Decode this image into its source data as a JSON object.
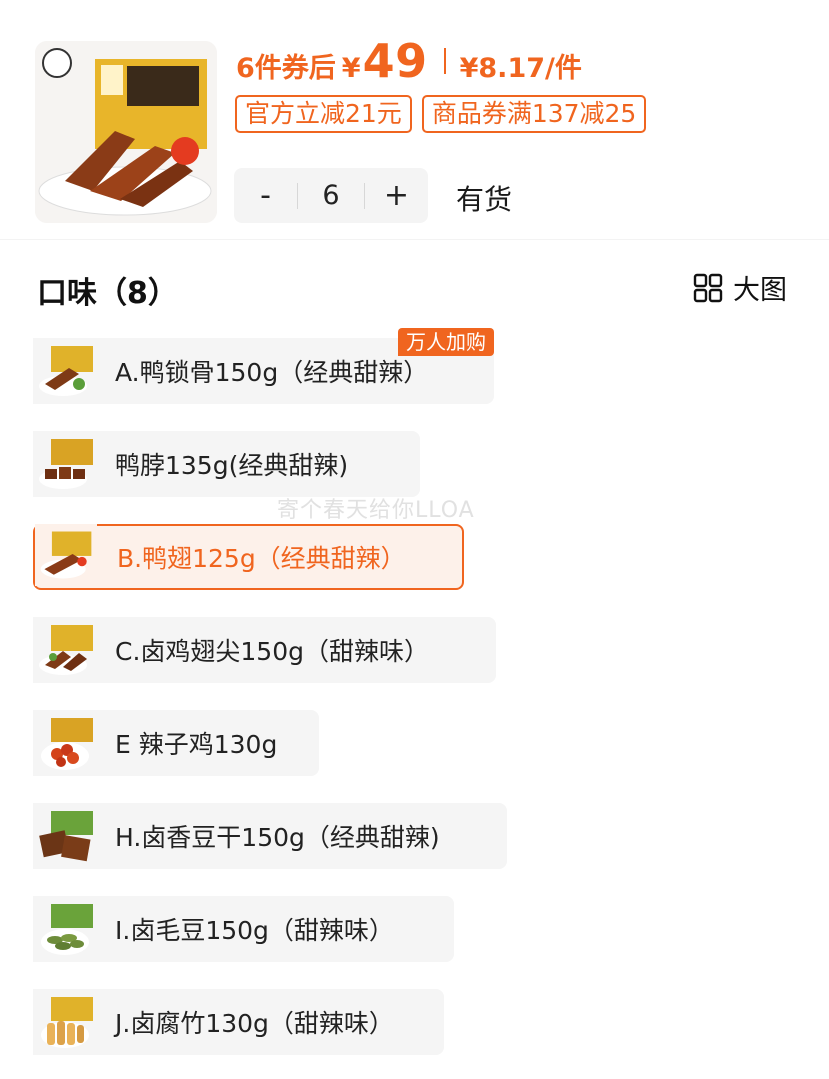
{
  "header": {
    "price_prefix": "6件券后",
    "yen": "¥",
    "price": "49",
    "unit_price": "¥8.17/件",
    "tags": [
      "官方立减21元",
      "商品券满137减25"
    ],
    "quantity": "6",
    "minus": "-",
    "plus": "+",
    "stock": "有货"
  },
  "flavor": {
    "title": "口味（8）",
    "view_label": "大图",
    "badge": "万人加购",
    "options": [
      "A.鸭锁骨150g（经典甜辣）",
      "鸭脖135g(经典甜辣)",
      "B.鸭翅125g（经典甜辣）",
      "C.卤鸡翅尖150g（甜辣味）",
      "E 辣子鸡130g",
      "H.卤香豆干150g（经典甜辣)",
      "I.卤毛豆150g（甜辣味）",
      "J.卤腐竹130g（甜辣味）"
    ],
    "selected_index": 2
  },
  "watermark": "寄个春天给你LLOA",
  "colors": {
    "accent": "#f0651f",
    "chip_bg": "#f5f5f5",
    "selected_bg": "#fdf1ea"
  }
}
